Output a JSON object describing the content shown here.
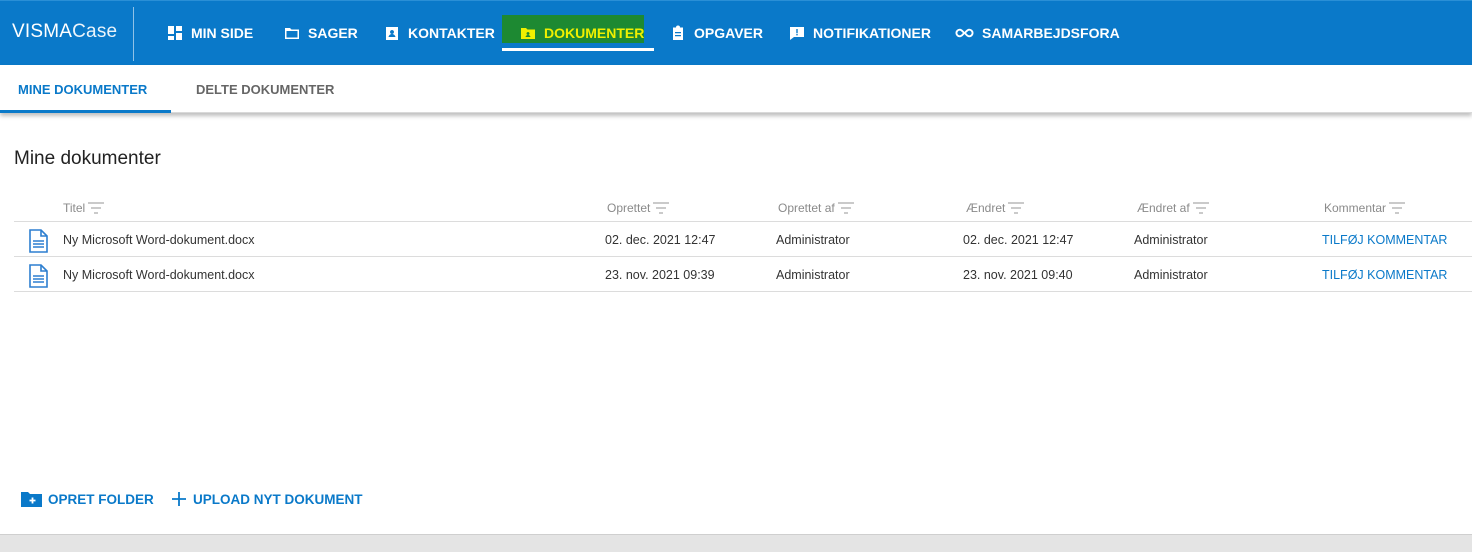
{
  "app": {
    "brand_main": "VISMA",
    "brand_sub": "Case"
  },
  "nav": {
    "items": [
      {
        "label": "MIN SIDE",
        "icon": "dashboard-icon"
      },
      {
        "label": "SAGER",
        "icon": "folder-icon"
      },
      {
        "label": "KONTAKTER",
        "icon": "contact-card-icon"
      },
      {
        "label": "DOKUMENTER",
        "icon": "shared-folder-icon",
        "active": true
      },
      {
        "label": "OPGAVER",
        "icon": "clipboard-icon"
      },
      {
        "label": "NOTIFIKATIONER",
        "icon": "feedback-icon"
      },
      {
        "label": "SAMARBEJDSFORA",
        "icon": "infinity-icon"
      }
    ],
    "active_highlight_color": "#1f8a2a",
    "active_text_color": "#f0f000"
  },
  "subtabs": [
    {
      "label": "MINE DOKUMENTER",
      "active": true
    },
    {
      "label": "DELTE DOKUMENTER",
      "active": false
    }
  ],
  "page": {
    "title": "Mine dokumenter"
  },
  "table": {
    "columns": [
      "Titel",
      "Oprettet",
      "Oprettet af",
      "Ændret",
      "Ændret af",
      "Kommentar"
    ],
    "rows": [
      {
        "title": "Ny Microsoft Word-dokument.docx",
        "created": "02. dec. 2021 12:47",
        "created_by": "Administrator",
        "modified": "02. dec. 2021 12:47",
        "modified_by": "Administrator",
        "comment_action": "TILFØJ KOMMENTAR"
      },
      {
        "title": "Ny Microsoft Word-dokument.docx",
        "created": "23. nov. 2021 09:39",
        "created_by": "Administrator",
        "modified": "23. nov. 2021 09:40",
        "modified_by": "Administrator",
        "comment_action": "TILFØJ KOMMENTAR"
      }
    ]
  },
  "actions": {
    "create_folder": "OPRET FOLDER",
    "upload_document": "UPLOAD NYT DOKUMENT"
  },
  "colors": {
    "primary": "#0a79c9"
  }
}
